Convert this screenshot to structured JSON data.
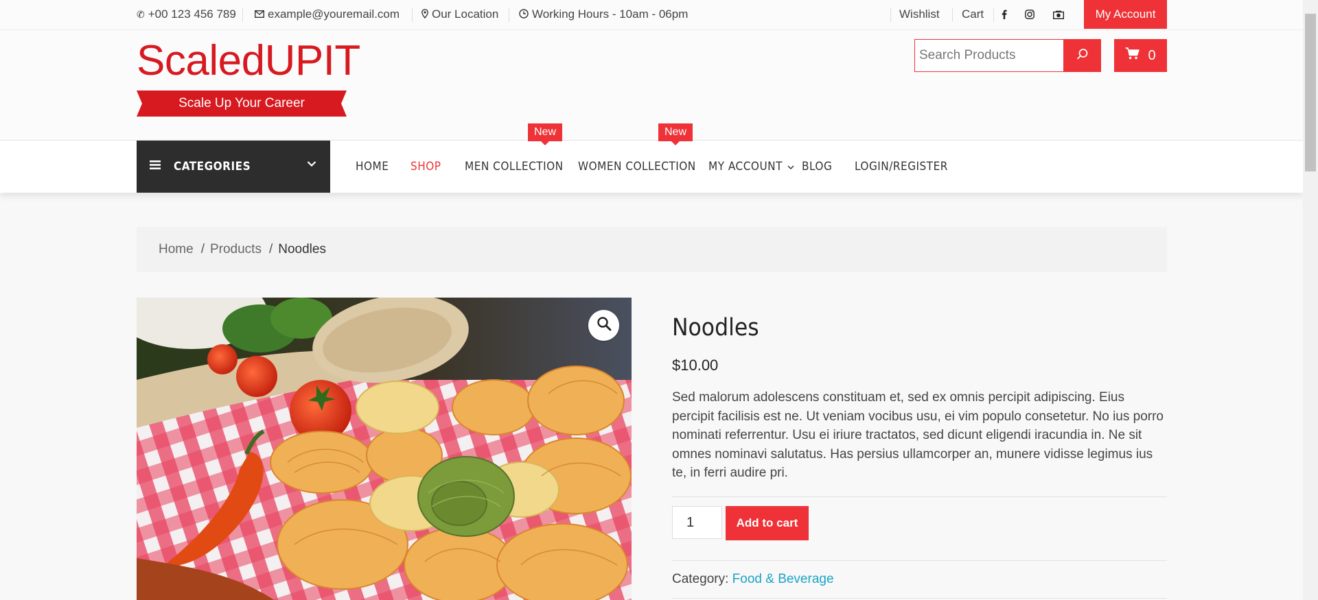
{
  "topbar": {
    "phone": "+00 123 456 789",
    "email": "example@youremail.com",
    "location": "Our Location",
    "hours": "Working Hours - 10am - 06pm",
    "wishlist": "Wishlist",
    "cart": "Cart",
    "my_account": "My Account",
    "social_icons": [
      "facebook-icon",
      "instagram-icon",
      "camera-icon"
    ]
  },
  "header": {
    "logo_text": "ScaledUPIT",
    "logo_tagline": "Scale Up Your Career",
    "search_placeholder": "Search Products",
    "cart_count": "0"
  },
  "nav": {
    "categories_label": "CATEGORIES",
    "items": [
      {
        "label": "HOME"
      },
      {
        "label": "SHOP",
        "active": true
      },
      {
        "label": "MEN COLLECTION",
        "badge": "New"
      },
      {
        "label": "WOMEN COLLECTION",
        "badge": "New"
      },
      {
        "label": "MY ACCOUNT"
      },
      {
        "label": "BLOG"
      },
      {
        "label": "LOGIN/REGISTER"
      }
    ]
  },
  "breadcrumb": {
    "home": "Home",
    "products": "Products",
    "current": "Noodles",
    "separator": "/"
  },
  "product": {
    "title": "Noodles",
    "price": "$10.00",
    "description": "Sed malorum adolescens constituam et, sed ex omnis percipit adipiscing. Eius percipit facilisis est ne. Ut veniam vocibus usu, ei vim populo consetetur. No ius porro nominati referrentur. Usu ei iriure tractatos, sed dicunt eligendi iracundia in. Ne sit omnes nominavi salutatus. Has persius ullamcorper an, munere vidisse legimus ius te, in ferri audire pri.",
    "quantity": "1",
    "add_to_cart": "Add to cart",
    "category_label": "Category:",
    "category": "Food & Beverage"
  },
  "colors": {
    "accent": "#ee3237",
    "logo": "#d71920",
    "dark": "#2d2d2d",
    "link": "#1aa3c5"
  }
}
